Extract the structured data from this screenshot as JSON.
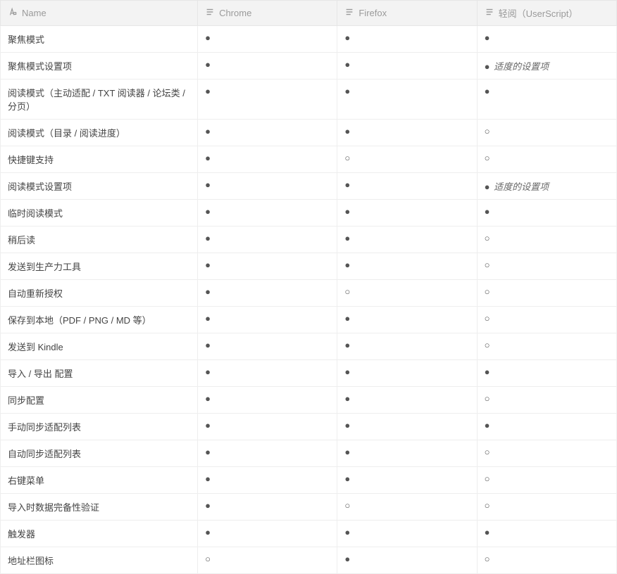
{
  "columns": {
    "name": {
      "label": "Name",
      "icon": "text-type-icon"
    },
    "chrome": {
      "label": "Chrome",
      "icon": "list-icon"
    },
    "firefox": {
      "label": "Firefox",
      "icon": "list-icon"
    },
    "user": {
      "label": "轻阅（UserScript）",
      "icon": "list-icon"
    }
  },
  "symbols": {
    "filled": "●",
    "empty": "○"
  },
  "rows": [
    {
      "name": "聚焦模式",
      "chrome": "●",
      "firefox": "●",
      "user": "●"
    },
    {
      "name": "聚焦模式设置项",
      "chrome": "●",
      "firefox": "●",
      "user": "●",
      "user_note": "适度的设置项"
    },
    {
      "name": "阅读模式（主动适配 / TXT 阅读器 / 论坛类 / 分页）",
      "chrome": "●",
      "firefox": "●",
      "user": "●"
    },
    {
      "name": "阅读模式（目录 / 阅读进度）",
      "chrome": "●",
      "firefox": "●",
      "user": "○"
    },
    {
      "name": "快捷键支持",
      "chrome": "●",
      "firefox": "○",
      "user": "○"
    },
    {
      "name": "阅读模式设置项",
      "chrome": "●",
      "firefox": "●",
      "user": "●",
      "user_note": "适度的设置项"
    },
    {
      "name": "临时阅读模式",
      "chrome": "●",
      "firefox": "●",
      "user": "●"
    },
    {
      "name": "稍后读",
      "chrome": "●",
      "firefox": "●",
      "user": "○"
    },
    {
      "name": "发送到生产力工具",
      "chrome": "●",
      "firefox": "●",
      "user": "○"
    },
    {
      "name": "自动重新授权",
      "chrome": "●",
      "firefox": "○",
      "user": "○"
    },
    {
      "name": "保存到本地（PDF / PNG / MD 等）",
      "chrome": "●",
      "firefox": "●",
      "user": "○"
    },
    {
      "name": "发送到 Kindle",
      "chrome": "●",
      "firefox": "●",
      "user": "○"
    },
    {
      "name": "导入 / 导出 配置",
      "chrome": "●",
      "firefox": "●",
      "user": "●"
    },
    {
      "name": "同步配置",
      "chrome": "●",
      "firefox": "●",
      "user": "○"
    },
    {
      "name": "手动同步适配列表",
      "chrome": "●",
      "firefox": "●",
      "user": "●"
    },
    {
      "name": "自动同步适配列表",
      "chrome": "●",
      "firefox": "●",
      "user": "○"
    },
    {
      "name": "右键菜单",
      "chrome": "●",
      "firefox": "●",
      "user": "○"
    },
    {
      "name": "导入时数据完备性验证",
      "chrome": "●",
      "firefox": "○",
      "user": "○"
    },
    {
      "name": "触发器",
      "chrome": "●",
      "firefox": "●",
      "user": "●"
    },
    {
      "name": "地址栏图标",
      "chrome": "○",
      "firefox": "●",
      "user": "○"
    }
  ]
}
